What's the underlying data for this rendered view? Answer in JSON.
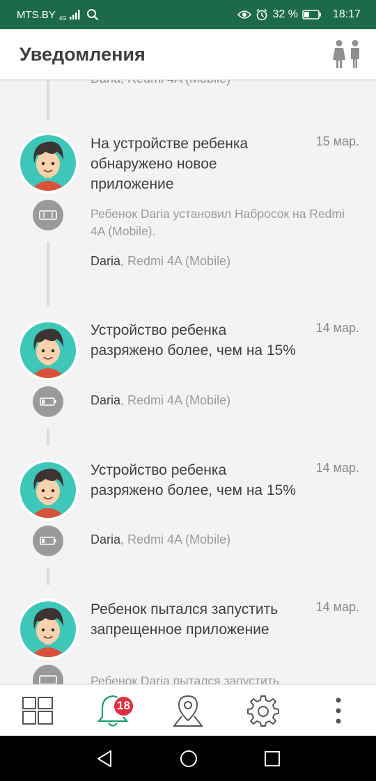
{
  "status_bar": {
    "carrier": "MTS.BY",
    "network": "4G",
    "battery": "32 %",
    "time": "18:17",
    "icons": [
      "signal-icon",
      "search-icon",
      "eye-icon",
      "alarm-icon",
      "battery-icon"
    ]
  },
  "header": {
    "title": "Уведомления",
    "action_icon": "parents-icon"
  },
  "notifications": [
    {
      "partial_meta": "Daria, Redmi 4A (Mobile)"
    },
    {
      "title": "На устройстве ребенка обнаружено новое приложение",
      "date": "15 мар.",
      "description": "Ребенок Daria установил Набросок на Redmi 4A (Mobile).",
      "child": "Daria",
      "device": ", Redmi 4A (Mobile)",
      "icon": "app-install-icon"
    },
    {
      "title": "Устройство ребенка разряжено более, чем на 15%",
      "date": "14 мар.",
      "child": "Daria",
      "device": ", Redmi 4A (Mobile)",
      "icon": "battery-low-icon"
    },
    {
      "title": "Устройство ребенка разряжено более, чем на 15%",
      "date": "14 мар.",
      "child": "Daria",
      "device": ", Redmi 4A (Mobile)",
      "icon": "battery-low-icon"
    },
    {
      "title": "Ребенок пытался запустить запрещенное приложение",
      "date": "14 мар.",
      "description": "Ребенок Daria пытался запустить",
      "icon": "app-blocked-icon"
    }
  ],
  "bottom_nav": {
    "items": [
      "dashboard-icon",
      "notifications-bell-icon",
      "location-pin-icon",
      "settings-gear-icon",
      "more-icon"
    ],
    "badge_count": "18",
    "accent": "#1e9b6e"
  },
  "colors": {
    "status_bar": "#1d6a4b",
    "avatar_bg": "#3ec7b8",
    "badge": "#e0303e"
  }
}
